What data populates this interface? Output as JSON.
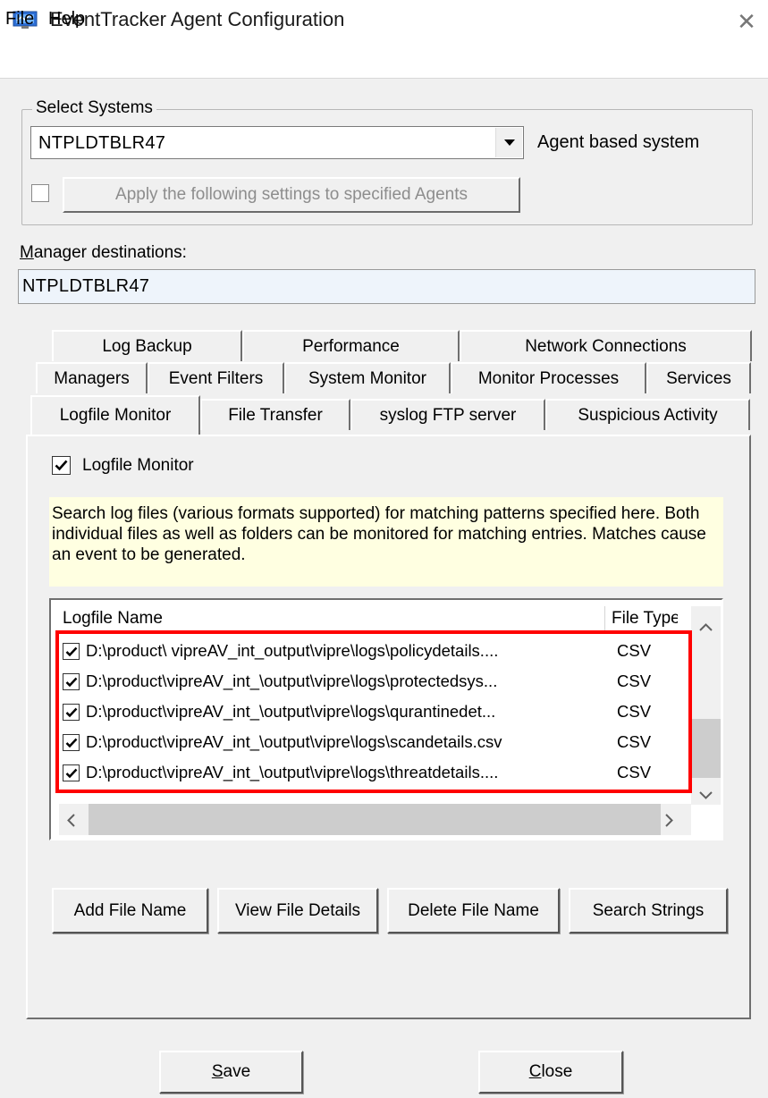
{
  "window": {
    "title": "EventTracker Agent Configuration",
    "close_glyph": "✕"
  },
  "menu": {
    "file": "File",
    "help": "Help"
  },
  "select_systems": {
    "legend": "Select Systems",
    "system_value": "NTPLDTBLR47",
    "system_type": "Agent based system",
    "apply_checked": false,
    "apply_button": "Apply the following settings to specified Agents"
  },
  "manager_destinations": {
    "label_first": "M",
    "label_rest": "anager destinations:",
    "value": "NTPLDTBLR47"
  },
  "tabs": {
    "row1": [
      "Log Backup",
      "Performance",
      "Network Connections"
    ],
    "row2": [
      "Managers",
      "Event Filters",
      "System Monitor",
      "Monitor Processes",
      "Services"
    ],
    "row3": [
      "Logfile Monitor",
      "File Transfer",
      "syslog FTP server",
      "Suspicious Activity"
    ],
    "active": "Logfile Monitor"
  },
  "logfile_monitor": {
    "enable_label": "Logfile Monitor",
    "enabled": true,
    "description": "Search log files (various formats supported) for matching patterns specified here. Both individual files as well as folders can be monitored for matching entries. Matches cause an event to be generated.",
    "columns": [
      "Logfile Name",
      "File Type"
    ],
    "rows": [
      {
        "name": "D:\\product\\ vipreAV_int_output\\vipre\\logs\\policydetails....",
        "type": "CSV",
        "checked": true
      },
      {
        "name": "D:\\product\\vipreAV_int_\\output\\vipre\\logs\\protectedsys...",
        "type": "CSV",
        "checked": true
      },
      {
        "name": "D:\\product\\vipreAV_int_\\output\\vipre\\logs\\qurantinedet...",
        "type": "CSV",
        "checked": true
      },
      {
        "name": "D:\\product\\vipreAV_int_\\output\\vipre\\logs\\scandetails.csv",
        "type": "CSV",
        "checked": true
      },
      {
        "name": "D:\\product\\vipreAV_int_\\output\\vipre\\logs\\threatdetails....",
        "type": "CSV",
        "checked": true
      }
    ],
    "buttons": {
      "add": "Add File Name",
      "view": "View File Details",
      "delete": "Delete File Name",
      "search": "Search Strings"
    }
  },
  "footer": {
    "save_first": "S",
    "save_rest": "ave",
    "close_first": "C",
    "close_rest": "lose"
  },
  "colors": {
    "highlight": "#ff0000",
    "info_bg": "#ffffe1",
    "field_bg": "#eef4fb"
  }
}
